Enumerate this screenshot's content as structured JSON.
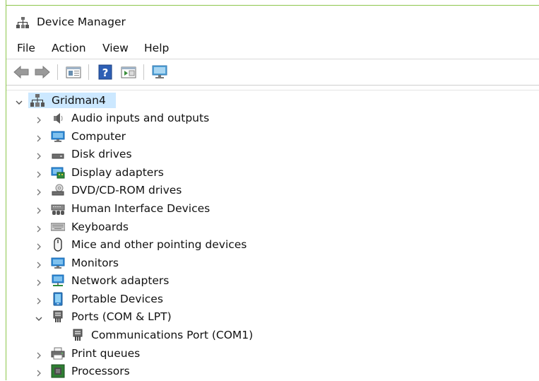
{
  "window": {
    "title": "Device Manager",
    "title_icon": "device-manager-icon",
    "accent_border": "#8dc64b"
  },
  "menu": {
    "items": [
      "File",
      "Action",
      "View",
      "Help"
    ]
  },
  "toolbar": {
    "buttons": [
      "back-arrow-icon",
      "forward-arrow-icon",
      "properties-pane-icon",
      "help-icon",
      "run-pane-icon",
      "scan-hardware-monitor-icon"
    ]
  },
  "tree": {
    "selection_color": "#cce8ff",
    "root": {
      "label": "Gridman4",
      "expanded": true,
      "icon": "computer-tower-icon"
    },
    "nodes": [
      {
        "label": "Audio inputs and outputs",
        "icon": "speaker-icon",
        "expanded": false
      },
      {
        "label": "Computer",
        "icon": "monitor-icon",
        "expanded": false
      },
      {
        "label": "Disk drives",
        "icon": "disk-drive-icon",
        "expanded": false
      },
      {
        "label": "Display adapters",
        "icon": "display-adapter-icon",
        "expanded": false
      },
      {
        "label": "DVD/CD-ROM drives",
        "icon": "dvd-drive-icon",
        "expanded": false
      },
      {
        "label": "Human Interface Devices",
        "icon": "hid-icon",
        "expanded": false
      },
      {
        "label": "Keyboards",
        "icon": "keyboard-icon",
        "expanded": false
      },
      {
        "label": "Mice and other pointing devices",
        "icon": "mouse-icon",
        "expanded": false
      },
      {
        "label": "Monitors",
        "icon": "monitor-icon",
        "expanded": false
      },
      {
        "label": "Network adapters",
        "icon": "network-adapter-icon",
        "expanded": false
      },
      {
        "label": "Portable Devices",
        "icon": "portable-device-icon",
        "expanded": false
      },
      {
        "label": "Ports (COM & LPT)",
        "icon": "port-icon",
        "expanded": true,
        "children": [
          {
            "label": "Communications Port (COM1)",
            "icon": "port-icon"
          }
        ]
      },
      {
        "label": "Print queues",
        "icon": "printer-icon",
        "expanded": false
      },
      {
        "label": "Processors",
        "icon": "processor-icon",
        "expanded": false
      }
    ]
  }
}
